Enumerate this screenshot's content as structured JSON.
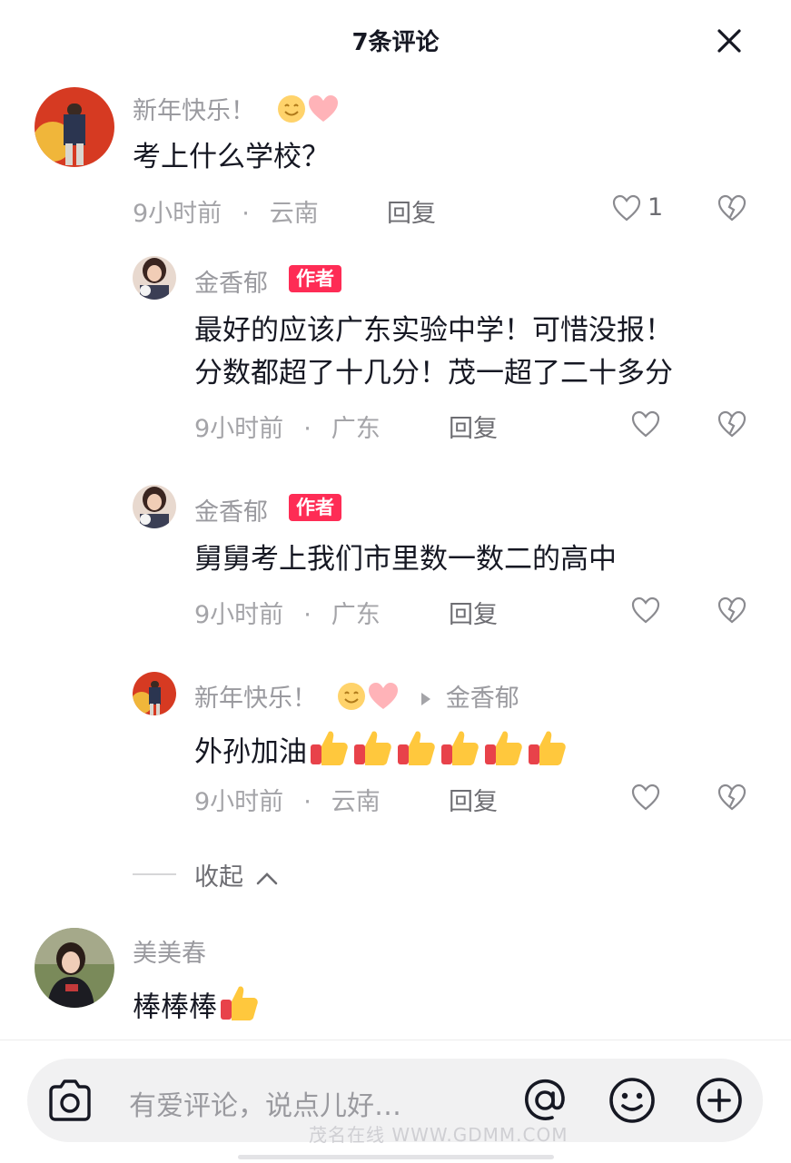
{
  "header": {
    "title": "7条评论"
  },
  "comments": [
    {
      "name": "新年快乐！",
      "text": "考上什么学校？",
      "time": "9小时前",
      "location": "云南",
      "reply": "回复",
      "likes": "1"
    }
  ],
  "replies": [
    {
      "name": "金香郁",
      "badge": "作者",
      "line1": "最好的应该广东实验中学！可惜没报！",
      "line2": "分数都超了十几分！茂一超了二十多分",
      "time": "9小时前",
      "location": "广东",
      "reply": "回复"
    },
    {
      "name": "金香郁",
      "badge": "作者",
      "line1": "舅舅考上我们市里数一数二的高中",
      "time": "9小时前",
      "location": "广东",
      "reply": "回复"
    },
    {
      "name": "新年快乐！",
      "reply_to": "金香郁",
      "line1": "外孙加油",
      "time": "9小时前",
      "location": "云南",
      "reply": "回复"
    }
  ],
  "collapse": {
    "label": "收起"
  },
  "comment2": {
    "name": "美美春",
    "text": "棒棒棒"
  },
  "composer": {
    "placeholder": "有爱评论，说点儿好…"
  },
  "watermark": "茂名在线 WWW.GDMM.COM",
  "colors": {
    "accent": "#fe2c55",
    "text": "#161823",
    "muted": "#9a9a9f"
  }
}
